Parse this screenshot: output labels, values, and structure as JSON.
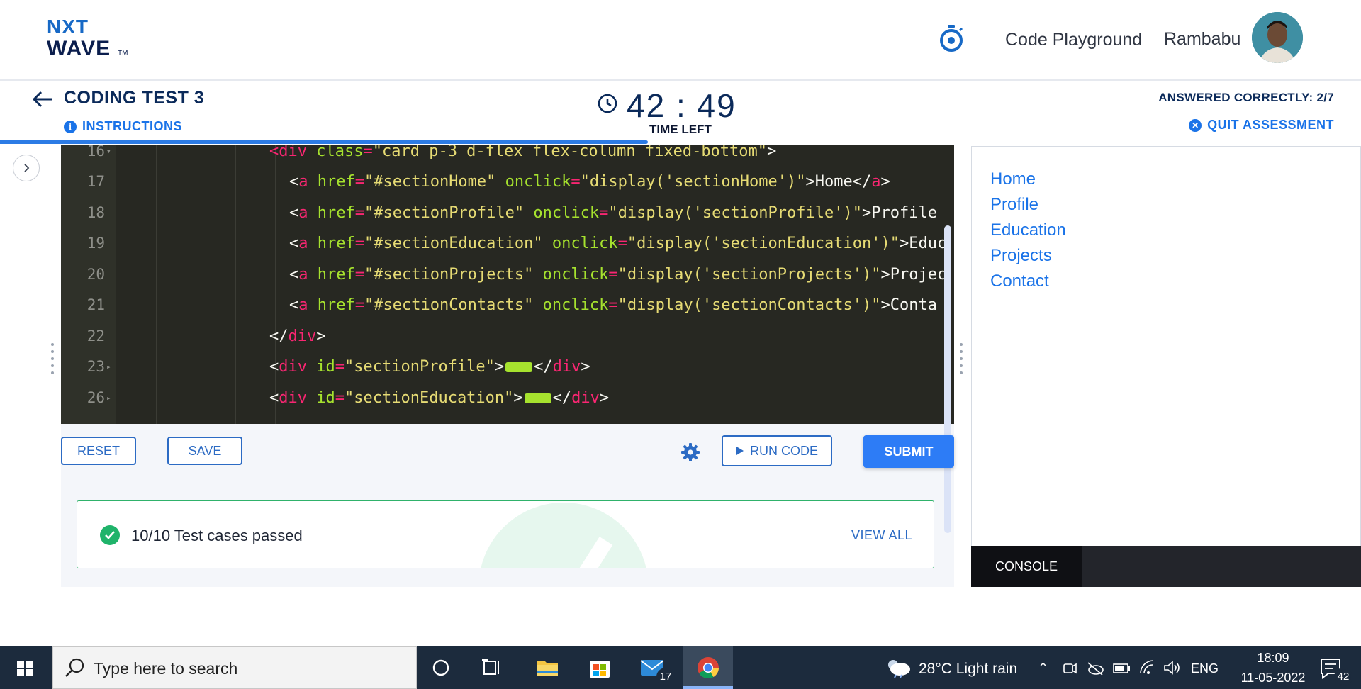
{
  "header": {
    "logo_line1": "NXT",
    "logo_line2": "WAVE",
    "logo_tm": "TM",
    "timer_icon": "stopwatch-icon",
    "playground_label": "Code Playground",
    "user_name": "Rambabu"
  },
  "test": {
    "title": "CODING TEST 3",
    "instructions_label": "INSTRUCTIONS",
    "time_value": "42 : 49",
    "time_left_label": "TIME LEFT",
    "answered_text": "ANSWERED CORRECTLY: 2/7",
    "quit_label": "QUIT ASSESSMENT"
  },
  "editor": {
    "lines": [
      {
        "num": "16",
        "folded": true
      },
      {
        "num": "17",
        "folded": false
      },
      {
        "num": "18",
        "folded": false
      },
      {
        "num": "19",
        "folded": false
      },
      {
        "num": "20",
        "folded": false
      },
      {
        "num": "21",
        "folded": false
      },
      {
        "num": "22",
        "folded": false
      },
      {
        "num": "23",
        "folded": true
      },
      {
        "num": "26",
        "folded": true
      }
    ],
    "code": {
      "l16": {
        "open": "<",
        "tag": "div",
        "attr": " class",
        "eq": "=",
        "val": "\"card p-3 d-flex flex-column fixed-bottom\"",
        "close": ">"
      },
      "l17": {
        "open": "<",
        "tag": "a",
        "attr1": " href",
        "val1": "\"#sectionHome\"",
        "attr2": " onclick",
        "val2": "\"display('sectionHome')\"",
        "text": ">Home</",
        "tag2": "a",
        "close": ">"
      },
      "l18": {
        "open": "<",
        "tag": "a",
        "attr1": " href",
        "val1": "\"#sectionProfile\"",
        "attr2": " onclick",
        "val2": "\"display('sectionProfile')\"",
        "text": ">Profile"
      },
      "l19": {
        "open": "<",
        "tag": "a",
        "attr1": " href",
        "val1": "\"#sectionEducation\"",
        "attr2": " onclick",
        "val2": "\"display('sectionEducation')\"",
        "text": ">Educ"
      },
      "l20": {
        "open": "<",
        "tag": "a",
        "attr1": " href",
        "val1": "\"#sectionProjects\"",
        "attr2": " onclick",
        "val2": "\"display('sectionProjects')\"",
        "text": ">Projec"
      },
      "l21": {
        "open": "<",
        "tag": "a",
        "attr1": " href",
        "val1": "\"#sectionContacts\"",
        "attr2": " onclick",
        "val2": "\"display('sectionContacts')\"",
        "text": ">Conta"
      },
      "l22": {
        "open": "</",
        "tag": "div",
        "close": ">"
      },
      "l23": {
        "open": "<",
        "tag": "div",
        "attr": " id",
        "eq": "=",
        "val": "\"sectionProfile\"",
        "close": ">",
        "close2": "</",
        "tag2": "div",
        "close3": ">"
      },
      "l26": {
        "open": "<",
        "tag": "div",
        "attr": " id",
        "eq": "=",
        "val": "\"sectionEducation\"",
        "close": ">",
        "close2": "</",
        "tag2": "div",
        "close3": ">"
      }
    }
  },
  "actions": {
    "reset_label": "RESET",
    "save_label": "SAVE",
    "settings_icon": "gear-icon",
    "run_label": "RUN CODE",
    "submit_label": "SUBMIT"
  },
  "result": {
    "text": "10/10 Test cases passed",
    "view_all_label": "VIEW ALL"
  },
  "preview": {
    "links": [
      "Home",
      "Profile",
      "Education",
      "Projects",
      "Contact"
    ],
    "console_label": "CONSOLE"
  },
  "taskbar": {
    "search_placeholder": "Type here to search",
    "mail_badge": "17",
    "weather_text": "28°C  Light rain",
    "lang": "ENG",
    "time": "18:09",
    "date": "11-05-2022",
    "notif_badge": "42"
  },
  "colors": {
    "accent": "#1a73e8",
    "submit_bg": "#2d7cf6",
    "editor_bg": "#272822",
    "success": "#1fb36a"
  }
}
